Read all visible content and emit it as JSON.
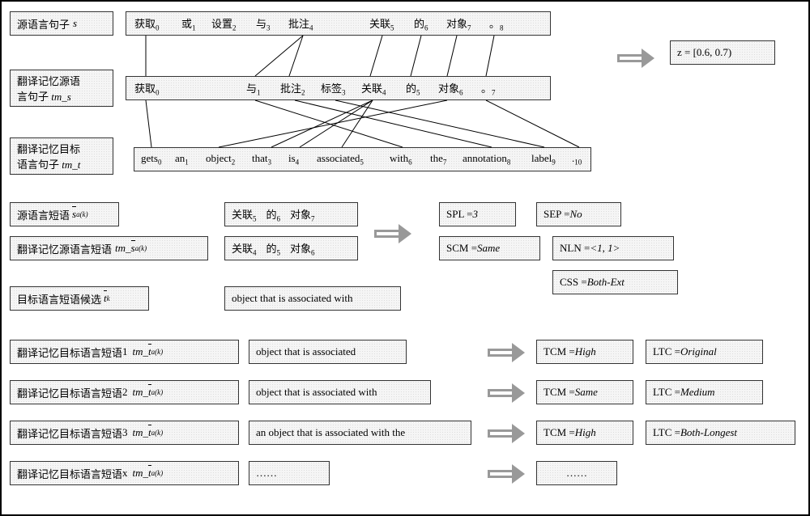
{
  "labels": {
    "source_sentence": "源语言句子",
    "s_var": "s",
    "tm_src_sentence": "翻译记忆源语",
    "tm_src_sentence2": "言句子",
    "tm_s_var": "tm_s",
    "tm_tgt_sentence": "翻译记忆目标",
    "tm_tgt_sentence2": "语言句子",
    "tm_t_var": "tm_t",
    "src_phrase": "源语言短语",
    "tm_src_phrase": "翻译记忆源语言短语",
    "tgt_phrase_cand": "目标语言短语候选",
    "tm_tgt_phrase": "翻译记忆目标语言短语",
    "s_ak": "s",
    "s_ak_sub": "a(k)",
    "tm_s_ak": "tm_s",
    "t_k": "t",
    "t_k_sub": "k",
    "tm_t_ak": "tm_t",
    "num1": "1",
    "num2": "2",
    "num3": "3",
    "numx": "x"
  },
  "tokens": {
    "s": [
      "获取",
      "或",
      "设置",
      "与",
      "批注",
      "关联",
      "的",
      "对象",
      "。"
    ],
    "s_idx": [
      "0",
      "1",
      "2",
      "3",
      "4",
      "5",
      "6",
      "7",
      "8"
    ],
    "tm_s": [
      "获取",
      "与",
      "批注",
      "标签",
      "关联",
      "的",
      "对象",
      "。"
    ],
    "tm_s_idx": [
      "0",
      "1",
      "2",
      "3",
      "4",
      "5",
      "6",
      "7"
    ],
    "tm_t": [
      "gets",
      "an",
      "object",
      "that",
      "is",
      "associated",
      "with",
      "the",
      "annotation",
      "label",
      "."
    ],
    "tm_t_idx": [
      "0",
      "1",
      "2",
      "3",
      "4",
      "5",
      "6",
      "7",
      "8",
      "9",
      "10"
    ]
  },
  "phrases": {
    "src_phrase": [
      "关联",
      "的",
      "对象"
    ],
    "src_phrase_idx": [
      "5",
      "6",
      "7"
    ],
    "tm_src_phrase": [
      "关联",
      "的",
      "对象"
    ],
    "tm_src_phrase_idx": [
      "4",
      "5",
      "6"
    ],
    "tgt_cand": "object that is associated with",
    "tm_tgt_1": "object that is associated",
    "tm_tgt_2": "object that is associated with",
    "tm_tgt_3": "an object that is associated with the",
    "tm_tgt_x": "……"
  },
  "features": {
    "z": "z = [0.6, 0.7)",
    "spl": "SPL = ",
    "spl_v": "3",
    "sep": "SEP = ",
    "sep_v": "No",
    "scm": "SCM = ",
    "scm_v": "Same",
    "nln": "NLN = ",
    "nln_v": "<1, 1>",
    "css": "CSS = ",
    "css_v": "Both-Ext",
    "tcm1": "TCM = ",
    "tcm1_v": "High",
    "ltc1": "LTC = ",
    "ltc1_v": "Original",
    "tcm2": "TCM = ",
    "tcm2_v": "Same",
    "ltc2": "LTC = ",
    "ltc2_v": "Medium",
    "tcm3": "TCM = ",
    "tcm3_v": "High",
    "ltc3": "LTC = ",
    "ltc3_v": "Both-Longest",
    "tcmx": "……",
    "ltcx": "……"
  }
}
